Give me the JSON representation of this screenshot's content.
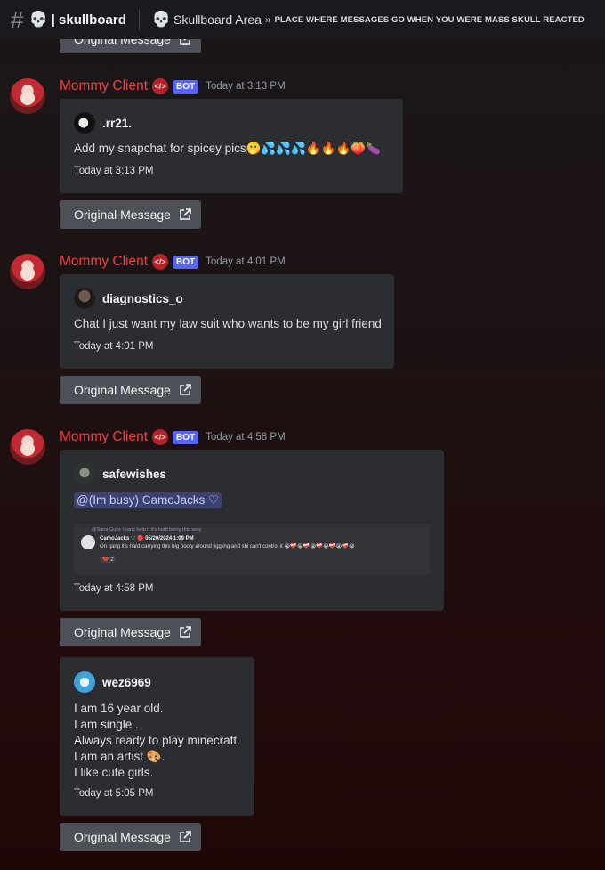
{
  "header": {
    "hash_icon": "#",
    "skull_icon": "💀",
    "channel_name": "| skullboard",
    "topic_icon": "💀",
    "topic_title": "Skullboard Area",
    "topic_separator": "»",
    "topic_desc": "PLACE WHERE MESSAGES GO WHEN YOU WERE MASS SKULL REACTED"
  },
  "top_cut_button": {
    "label": "Original Message"
  },
  "messages": [
    {
      "author": "Mommy Client",
      "bot_tag": "BOT",
      "role_icon": "</>",
      "timestamp": "Today at 3:13 PM",
      "embed": {
        "author": ".rr21.",
        "text": "Add my snapchat for spicey pics🫢💦💦💦🔥🔥🔥🍑🍆",
        "footer": "Today at 3:13 PM"
      },
      "button": "Original Message"
    },
    {
      "author": "Mommy Client",
      "bot_tag": "BOT",
      "role_icon": "</>",
      "timestamp": "Today at 4:01 PM",
      "embed": {
        "author": "diagnostics_o",
        "text": "Chat I just want my law suit who wants to be my girl friend",
        "footer": "Today at 4:01 PM"
      },
      "button": "Original Message"
    },
    {
      "author": "Mommy Client",
      "bot_tag": "BOT",
      "role_icon": "</>",
      "timestamp": "Today at 4:58 PM",
      "embed": {
        "author": "safewishes",
        "mention": "@(Im busy) CamoJacks ♡",
        "quote": {
          "reply_line": "@Sana Guys I can't help it it's hard being this sexy",
          "name": "CamoJacks ♡ 🔴 05/20/2024 1:09 PM",
          "text": "On gang it's hard carrying this big booty around jiggling and shi can't control it 😭❤️‍🩹😭❤️‍🩹😭❤️‍🩹😭❤️‍🩹😭❤️‍🩹😭",
          "reaction": "💔 2"
        },
        "footer": "Today at 4:58 PM"
      },
      "button": "Original Message"
    },
    {
      "embed": {
        "author": "wez6969",
        "lines": [
          "I am 16 year old.",
          "I am single .",
          "Always ready to play minecraft.",
          "I am an artist 🎨.",
          "I like cute girls."
        ],
        "footer": "Today at 5:05 PM"
      },
      "button": "Original Message"
    }
  ],
  "colors": {
    "author": "#f23f43",
    "bot_tag": "#5865f2",
    "embed_bg": "#2b2d31",
    "button_bg": "#4e5058"
  }
}
